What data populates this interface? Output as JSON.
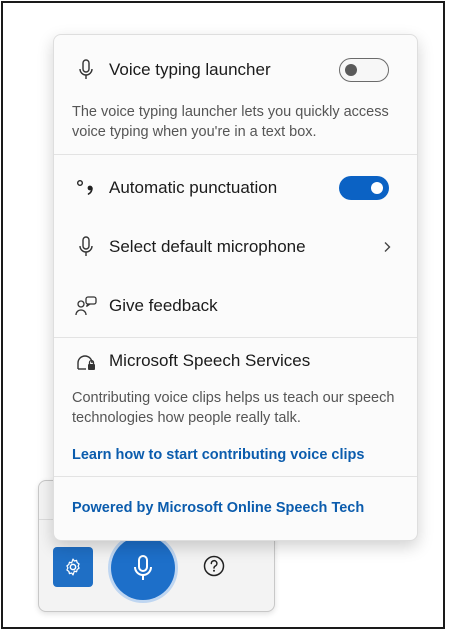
{
  "menu": {
    "voice_typing_launcher": {
      "label": "Voice typing launcher",
      "toggle_on": false,
      "description": "The voice typing launcher lets you quickly access voice typing when you're in a text box."
    },
    "automatic_punctuation": {
      "label": "Automatic punctuation",
      "toggle_on": true
    },
    "select_microphone": {
      "label": "Select default microphone"
    },
    "give_feedback": {
      "label": "Give feedback"
    },
    "speech_services": {
      "label": "Microsoft Speech Services",
      "description": "Contributing voice clips helps us teach our speech technologies how people really talk.",
      "link": "Learn how to start contributing voice clips"
    },
    "powered_by": "Powered by Microsoft Online Speech Tech"
  },
  "icons": {
    "microphone": "microphone-icon",
    "punctuation": "punctuation-icon",
    "feedback": "feedback-icon",
    "speech_services": "speech-services-icon",
    "settings": "gear-icon",
    "help": "help-icon",
    "chevron": "chevron-right-icon"
  },
  "colors": {
    "accent": "#0b62c4",
    "link": "#0b5cad",
    "settings_button": "#1f6fc5"
  }
}
